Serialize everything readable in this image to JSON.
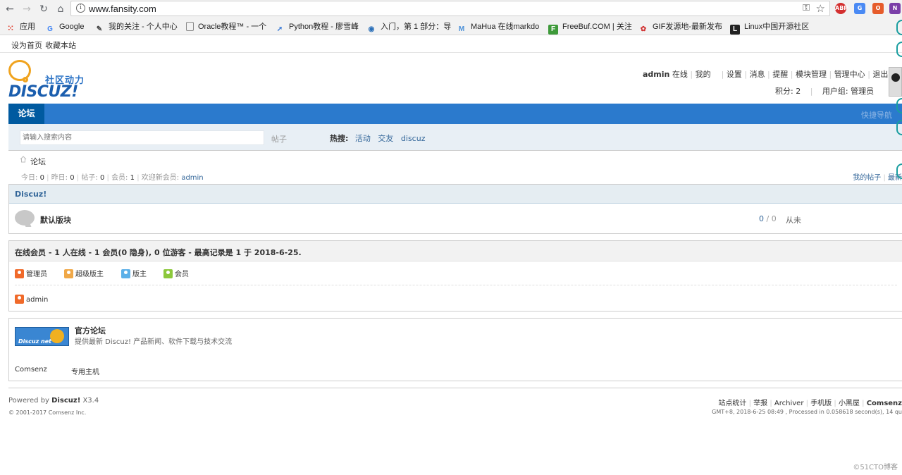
{
  "browser": {
    "url": "www.fansity.com",
    "bookmarks": [
      {
        "label": "应用",
        "icon": "apps-grid-icon",
        "color": "#e04030"
      },
      {
        "label": "Google",
        "icon": "google-icon",
        "color": "#4285f4"
      },
      {
        "label": "我的关注 - 个人中心",
        "icon": "bookmark-favicon",
        "color": "#444444"
      },
      {
        "label": "Oracle教程™ - 一个",
        "icon": "document-icon",
        "color": "#666666"
      },
      {
        "label": "Python教程 - 廖雪峰",
        "icon": "rocket-icon",
        "color": "#3c7bd6"
      },
      {
        "label": "入门，第 1 部分：导",
        "icon": "globe-icon",
        "color": "#2a6fb8"
      },
      {
        "label": "MaHua 在线markdo",
        "icon": "m-icon",
        "color": "#4a8fd8"
      },
      {
        "label": "FreeBuf.COM | 关注",
        "icon": "freebuf-icon",
        "color": "#3e9a3a"
      },
      {
        "label": "GIF发源地-最新发布",
        "icon": "gif-icon",
        "color": "#d03030"
      },
      {
        "label": "Linux中国开源社区",
        "icon": "linux-icon",
        "color": "#222222"
      }
    ]
  },
  "topbar": {
    "set_home": "设为首页",
    "favorite": "收藏本站"
  },
  "logo": {
    "sub": "社区动力",
    "main": "DISCUZ!"
  },
  "user": {
    "name": "admin",
    "status": "在线",
    "my": "我的",
    "links": [
      "设置",
      "消息",
      "提醒",
      "模块管理",
      "管理中心",
      "退出"
    ],
    "credits": "积分: 2",
    "group": "用户组: 管理员"
  },
  "nav": {
    "active": "论坛",
    "quick": "快捷导航"
  },
  "search": {
    "placeholder": "请输入搜索内容",
    "type": "帖子",
    "hot_label": "热搜:",
    "hot": [
      "活动",
      "交友",
      "discuz"
    ]
  },
  "breadcrumb": {
    "current": "论坛"
  },
  "stats": {
    "today_label": "今日:",
    "today": "0",
    "yesterday_label": "昨日:",
    "yesterday": "0",
    "posts_label": "帖子:",
    "posts": "0",
    "members_label": "会员:",
    "members": "1",
    "newest_label": "欢迎新会员:",
    "newest": "admin",
    "my_posts": "我的帖子",
    "latest": "最新"
  },
  "category": {
    "title": "Discuz!",
    "forum_name": "默认版块",
    "threads": "0",
    "slash": "/",
    "posts": "0",
    "last_post": "从未"
  },
  "online": {
    "title": "在线会员 - 1 人在线 - 1 会员(0 隐身), 0 位游客 - 最高记录是 1 于 2018-6-25.",
    "groups": [
      {
        "label": "管理员",
        "color": "#f06a2a"
      },
      {
        "label": "超级版主",
        "color": "#f0a848"
      },
      {
        "label": "版主",
        "color": "#5cb0e8"
      },
      {
        "label": "会员",
        "color": "#8cc83c"
      }
    ],
    "user": "admin"
  },
  "links": {
    "banner": "Discuz net",
    "official_title": "官方论坛",
    "official_desc": "提供最新 Discuz! 产品新闻、软件下载与技术交流",
    "text_links": [
      "Comsenz",
      "专用主机"
    ]
  },
  "footer": {
    "powered_prefix": "Powered by",
    "powered_brand": "Discuz!",
    "version": "X3.4",
    "copyright": "© 2001-2017 Comsenz Inc.",
    "links": [
      "站点统计",
      "举报",
      "Archiver",
      "手机版",
      "小黑屋"
    ],
    "company": "Comsenz",
    "debug": "GMT+8, 2018-6-25 08:49 , Processed in 0.058618 second(s), 14 qu"
  },
  "watermark": "©51CTO博客"
}
